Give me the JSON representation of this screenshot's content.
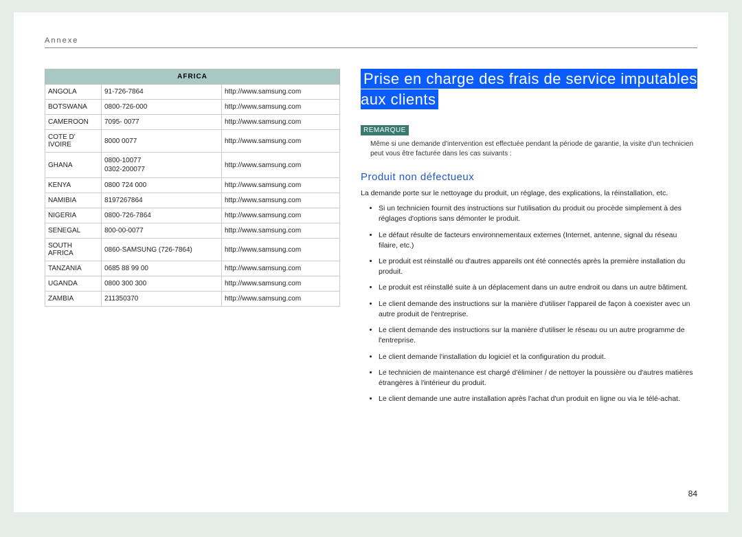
{
  "header": {
    "label": "Annexe"
  },
  "table": {
    "region_header": "AFRICA",
    "rows": [
      {
        "country": "ANGOLA",
        "phone": "91-726-7864",
        "url": "http://www.samsung.com"
      },
      {
        "country": "BOTSWANA",
        "phone": "0800-726-000",
        "url": "http://www.samsung.com"
      },
      {
        "country": "CAMEROON",
        "phone": "7095- 0077",
        "url": "http://www.samsung.com"
      },
      {
        "country": "COTE D' IVOIRE",
        "phone": "8000 0077",
        "url": "http://www.samsung.com"
      },
      {
        "country": "GHANA",
        "phone_lines": [
          "0800-10077",
          "0302-200077"
        ],
        "url": "http://www.samsung.com"
      },
      {
        "country": "KENYA",
        "phone": "0800 724 000",
        "url": "http://www.samsung.com"
      },
      {
        "country": "NAMIBIA",
        "phone": "8197267864",
        "url": "http://www.samsung.com"
      },
      {
        "country": "NIGERIA",
        "phone": "0800-726-7864",
        "url": "http://www.samsung.com"
      },
      {
        "country": "SENEGAL",
        "phone": "800-00-0077",
        "url": "http://www.samsung.com"
      },
      {
        "country": "SOUTH AFRICA",
        "phone": "0860-SAMSUNG (726-7864)",
        "url": "http://www.samsung.com"
      },
      {
        "country": "TANZANIA",
        "phone": "0685 88 99 00",
        "url": "http://www.samsung.com"
      },
      {
        "country": "UGANDA",
        "phone": "0800 300 300",
        "url": "http://www.samsung.com"
      },
      {
        "country": "ZAMBIA",
        "phone": "211350370",
        "url": "http://www.samsung.com"
      }
    ]
  },
  "right": {
    "title": "Prise en charge des frais de service imputables aux clients",
    "remarque_label": "REMARQUE",
    "remarque_text": "Même si une demande d'intervention est effectuée pendant la période de garantie, la visite d'un technicien peut vous être facturée dans les cas suivants :",
    "sub_heading": "Produit non défectueux",
    "intro": "La demande porte sur le nettoyage du produit, un réglage, des explications, la réinstallation, etc.",
    "bullets": [
      "Si un technicien fournit des instructions sur l'utilisation du produit ou procède simplement à des réglages d'options sans démonter le produit.",
      "Le défaut résulte de facteurs environnementaux externes (Internet, antenne, signal du réseau filaire, etc.)",
      "Le produit est réinstallé ou d'autres appareils ont été connectés après la première installation du produit.",
      "Le produit est réinstallé suite à un déplacement dans un autre endroit ou dans un autre bâtiment.",
      "Le client demande des instructions sur la manière d'utiliser l'appareil de façon à coexister avec un autre produit de l'entreprise.",
      "Le client demande des instructions sur la manière d'utiliser le réseau ou un autre programme de l'entreprise.",
      "Le client demande l'installation du logiciel et la configuration du produit.",
      "Le technicien de maintenance est chargé d'éliminer / de nettoyer la poussière ou d'autres matières étrangères à l'intérieur du produit.",
      "Le client demande une autre installation après l'achat d'un produit en ligne ou via le télé-achat."
    ]
  },
  "page_number": "84"
}
